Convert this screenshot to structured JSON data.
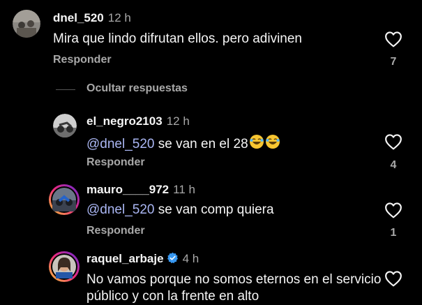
{
  "comment": {
    "username": "dnel_520",
    "time": "12 h",
    "text": "Mira que lindo difrutan ellos. pero adivinen",
    "reply_label": "Responder",
    "likes": "7"
  },
  "hide_replies_label": "Ocultar respuestas",
  "replies": [
    {
      "username": "el_negro2103",
      "time": "12 h",
      "mention": "@dnel_520",
      "text": " se van en el 28",
      "reply_label": "Responder",
      "likes": "4"
    },
    {
      "username": "mauro____972",
      "time": "11 h",
      "mention": "@dnel_520",
      "text": " se van comp quiera",
      "reply_label": "Responder",
      "likes": "1"
    },
    {
      "username": "raquel_arbaje",
      "time": "4 h",
      "text": "No vamos porque no somos eternos en el servicio público y con la frente en alto"
    }
  ],
  "colors": {
    "background": "#000000",
    "mention": "#aab6f3",
    "secondary_text": "#a8a8a8",
    "verified": "#3797f0"
  },
  "icons": {
    "like": "heart-outline-icon",
    "verified": "verified-badge-icon",
    "emoji": "laughing-emoji-icon"
  }
}
